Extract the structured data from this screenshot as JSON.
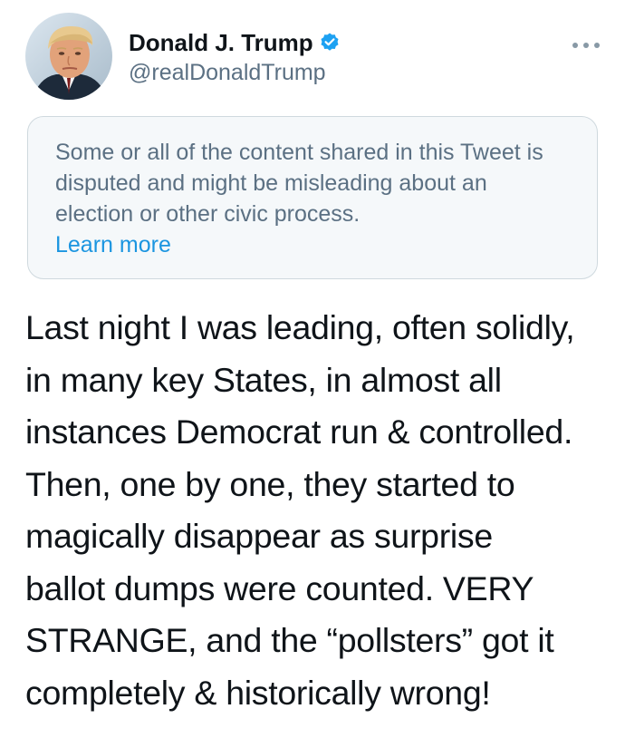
{
  "tweet": {
    "author": {
      "display_name": "Donald J. Trump",
      "handle": "@realDonaldTrump",
      "verified": true,
      "verified_icon": "verified-badge-icon",
      "avatar_icon": "profile-photo"
    },
    "more_icon": "more-options-icon",
    "notice": {
      "text": "Some or all of the content shared in this Tweet is disputed and might be misleading about an election or other civic process.",
      "link_label": "Learn more"
    },
    "body_lines": [
      "Last night I was leading, often solidly,",
      "in many key States, in almost all",
      "instances Democrat run & controlled.",
      "Then, one by one, they started to",
      "magically disappear as surprise",
      "ballot dumps were counted. VERY",
      "STRANGE, and the “pollsters” got it",
      "completely & historically wrong!"
    ]
  },
  "colors": {
    "text_primary": "#0f1419",
    "text_secondary": "#5b7083",
    "link": "#1b95e0",
    "verified": "#1da1f2",
    "notice_background": "#f5f8fa",
    "notice_border": "#cfd9de"
  }
}
